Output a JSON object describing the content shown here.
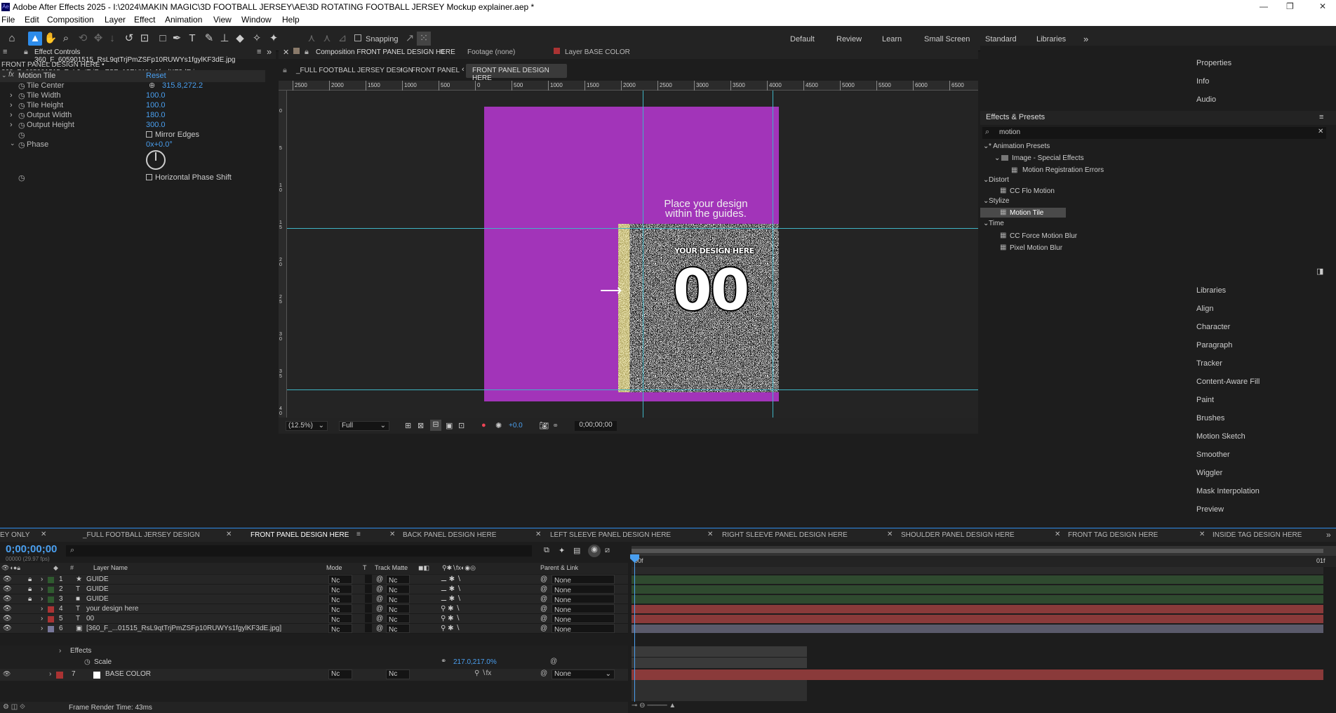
{
  "app": {
    "title": "Adobe After Effects 2025 - I:\\2024\\MAKIN MAGIC\\3D FOOTBALL JERSEY\\AE\\3D ROTATING FOOTBALL JERSEY Mockup explainer.aep *",
    "icon": "Ae"
  },
  "menu": [
    "File",
    "Edit",
    "Composition",
    "Layer",
    "Effect",
    "Animation",
    "View",
    "Window",
    "Help"
  ],
  "toolbar": {
    "snapping": "Snapping",
    "workspaces": [
      "Default",
      "Review",
      "Learn",
      "Small Screen",
      "Standard",
      "Libraries"
    ]
  },
  "effect_controls": {
    "tab": "Effect Controls 360_F_605901515_RsL9qtTrjPmZSFp10RUWYs1fgylKF3dE.jpg",
    "subtitle": "FRONT PANEL DESIGN HERE • 360_F_605901515_RsL9qtTrjPmZSFp10RUWYs1fgylKF3dE.jpg",
    "effect_name": "Motion Tile",
    "reset": "Reset",
    "props": [
      {
        "name": "Tile Center",
        "value": "315.8,272.2"
      },
      {
        "name": "Tile Width",
        "value": "100.0"
      },
      {
        "name": "Tile Height",
        "value": "100.0"
      },
      {
        "name": "Output Width",
        "value": "180.0"
      },
      {
        "name": "Output Height",
        "value": "300.0"
      }
    ],
    "mirror_edges": "Mirror Edges",
    "phase": {
      "name": "Phase",
      "value": "0x+0.0°"
    },
    "hps": "Horizontal Phase Shift"
  },
  "composition": {
    "tab": "Composition FRONT PANEL DESIGN HERE",
    "footage": "Footage (none)",
    "layer": "Layer BASE COLOR",
    "breadcrumbs": [
      "_FULL FOOTBALL JERSEY DESIGN",
      "FRONT PANEL",
      "FRONT PANEL DESIGN HERE"
    ],
    "ruler_top": [
      "2500",
      "2000",
      "1500",
      "1000",
      "500",
      "0",
      "500",
      "1000",
      "1500",
      "2000",
      "2500",
      "3000",
      "3500",
      "4000",
      "4500",
      "5000",
      "5500",
      "6000",
      "6500"
    ],
    "ruler_left": [
      "0",
      "5",
      "1 0",
      "1 5",
      "2 0",
      "2 5",
      "3 0",
      "3 5",
      "4 0"
    ],
    "canvas_text": "Place your design within the guides.",
    "design_label": "YOUR DESIGN HERE",
    "number": "00",
    "zoom": "(12.5%)",
    "resolution": "Full",
    "exposure": "+0.0",
    "timecode": "0;00;00;00"
  },
  "right_panel": {
    "items_top": [
      "Properties",
      "Info",
      "Audio"
    ],
    "effects_title": "Effects & Presets",
    "search": "motion",
    "tree": [
      {
        "label": "* Animation Presets",
        "indent": 0
      },
      {
        "label": "Image - Special Effects",
        "indent": 1
      },
      {
        "label": "Motion Registration Errors",
        "indent": 2
      },
      {
        "label": "Distort",
        "indent": 0
      },
      {
        "label": "CC Flo Motion",
        "indent": 1
      },
      {
        "label": "Stylize",
        "indent": 0
      },
      {
        "label": "Motion Tile",
        "indent": 1,
        "selected": true
      },
      {
        "label": "Time",
        "indent": 0
      },
      {
        "label": "CC Force Motion Blur",
        "indent": 1
      },
      {
        "label": "Pixel Motion Blur",
        "indent": 1
      }
    ],
    "items_bottom": [
      "Libraries",
      "Align",
      "Character",
      "Paragraph",
      "Tracker",
      "Content-Aware Fill",
      "Paint",
      "Brushes",
      "Motion Sketch",
      "Smoother",
      "Wiggler",
      "Mask Interpolation",
      "Preview"
    ]
  },
  "timeline": {
    "tabs": [
      "EY ONLY",
      "_FULL FOOTBALL JERSEY DESIGN",
      "FRONT PANEL DESIGN HERE",
      "BACK PANEL DESIGN HERE",
      "LEFT SLEEVE PANEL DESIGN HERE",
      "RIGHT SLEEVE PANEL DESIGN HERE",
      "SHOULDER PANEL DESIGN HERE",
      "FRONT TAG DESIGN HERE",
      "INSIDE TAG DESIGN HERE"
    ],
    "timecode": "0;00;00;00",
    "fps": "00000 (29.97 fps)",
    "headers": {
      "name": "Layer Name",
      "mode": "Mode",
      "t": "T",
      "track": "Track Matte",
      "parent": "Parent & Link"
    },
    "layers": [
      {
        "num": "1",
        "type": "★",
        "name": "GUIDE",
        "color": "#2f5a2f",
        "mode": "Nc",
        "matte": "Nc",
        "parent": "None"
      },
      {
        "num": "2",
        "type": "T",
        "name": "GUIDE",
        "color": "#2f5a2f",
        "mode": "Nc",
        "matte": "Nc",
        "parent": "None"
      },
      {
        "num": "3",
        "type": "■",
        "name": "GUIDE",
        "color": "#2f5a2f",
        "mode": "Nc",
        "matte": "Nc",
        "parent": "None"
      },
      {
        "num": "4",
        "type": "T",
        "name": "your design here",
        "color": "#a33",
        "mode": "Nc",
        "matte": "Nc",
        "parent": "None"
      },
      {
        "num": "5",
        "type": "T",
        "name": "00",
        "color": "#a33",
        "mode": "Nc",
        "matte": "Nc",
        "parent": "None"
      },
      {
        "num": "6",
        "type": "▣",
        "name": "[360_F_...01515_RsL9qtTrjPmZSFp10RUWYs1fgylKF3dE.jpg]",
        "color": "#77779a",
        "mode": "Nc",
        "matte": "Nc",
        "parent": "None"
      }
    ],
    "effects_label": "Effects",
    "scale_label": "Scale",
    "scale_value": "217.0,217.0%",
    "layer7": {
      "num": "7",
      "name": "BASE COLOR",
      "mode": "Nc",
      "matte": "Nc",
      "parent": "None"
    },
    "start": "00f",
    "end": "01f",
    "frame_render": "Frame Render Time: 43ms"
  }
}
